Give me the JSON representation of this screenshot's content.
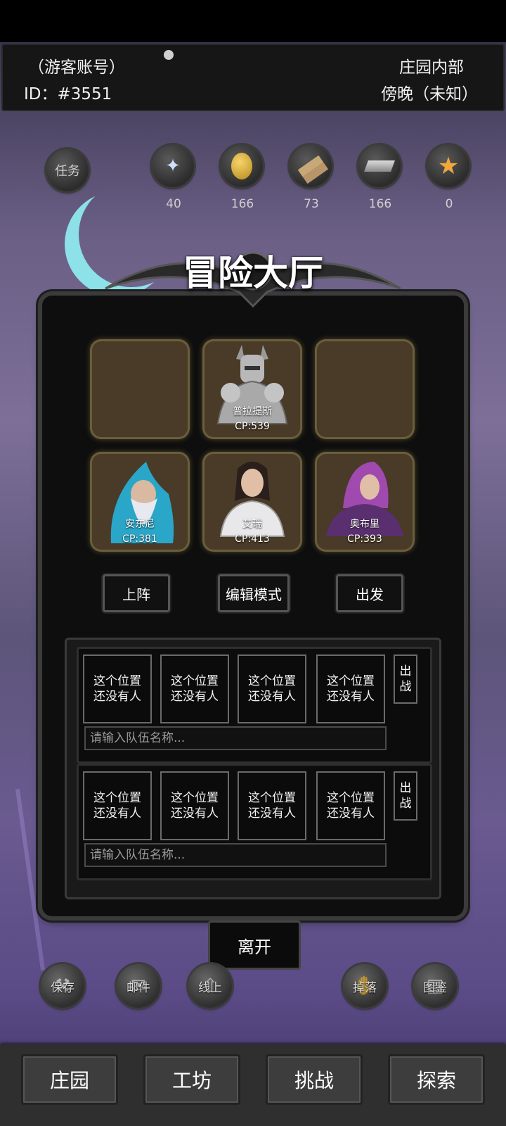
{
  "header": {
    "account": "（游客账号）",
    "id_label": "ID：#3551",
    "location": "庄园内部",
    "time_of_day": "傍晚（未知）"
  },
  "resources": [
    {
      "name": "quest",
      "label": "任务",
      "icon": "quest-icon"
    },
    {
      "name": "mana",
      "value": "40",
      "icon": "mana-crystal-icon"
    },
    {
      "name": "gold",
      "value": "166",
      "icon": "gold-coin-icon"
    },
    {
      "name": "wood",
      "value": "73",
      "icon": "wood-planks-icon"
    },
    {
      "name": "iron",
      "value": "166",
      "icon": "iron-ingot-icon"
    },
    {
      "name": "star",
      "value": "0",
      "icon": "star-icon"
    }
  ],
  "hall": {
    "title": "冒险大厅",
    "slots": [
      {
        "name": "",
        "cp": ""
      },
      {
        "name": "普拉提斯",
        "cp": "CP:539",
        "portrait": "knight-portrait"
      },
      {
        "name": "",
        "cp": ""
      },
      {
        "name": "安东尼",
        "cp": "CP:381",
        "portrait": "wizard-portrait"
      },
      {
        "name": "艾瑞",
        "cp": "CP:413",
        "portrait": "woman-portrait"
      },
      {
        "name": "奥布里",
        "cp": "CP:393",
        "portrait": "hooded-mage-portrait"
      }
    ],
    "buttons": {
      "deploy": "上阵",
      "edit": "编辑模式",
      "depart": "出发"
    }
  },
  "teams": [
    {
      "slots": [
        "这个位置\n还没有人",
        "这个位置\n还没有人",
        "这个位置\n还没有人",
        "这个位置\n还没有人"
      ],
      "name_placeholder": "请输入队伍名称...",
      "go": "出\n战"
    },
    {
      "slots": [
        "这个位置\n还没有人",
        "这个位置\n还没有人",
        "这个位置\n还没有人",
        "这个位置\n还没有人"
      ],
      "name_placeholder": "请输入队伍名称...",
      "go": "出\n战"
    }
  ],
  "leave": "离开",
  "round_buttons": [
    {
      "label": "保存",
      "icon": "anvil-icon"
    },
    {
      "label": "邮件",
      "icon": "mail-icon"
    },
    {
      "label": "线上",
      "icon": "upload-arrow-icon"
    },
    {
      "label": "掉落",
      "icon": "hand-icon"
    },
    {
      "label": "图鉴",
      "icon": "book-icon"
    }
  ],
  "nav": [
    "庄园",
    "工坊",
    "挑战",
    "探索"
  ]
}
